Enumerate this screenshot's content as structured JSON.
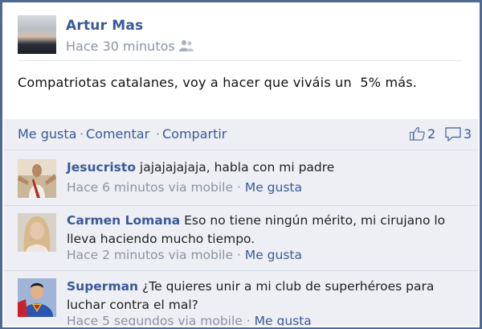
{
  "post": {
    "author": "Artur Mas",
    "time": "Hace 30 minutos",
    "text": "Compatriotas catalanes, voy a hacer que viváis un  5% más.",
    "audience_icon": "friends-icon"
  },
  "actions": {
    "like": "Me gusta",
    "dot1": "·",
    "comment": "Comentar",
    "dot2": "·",
    "share": "Compartir",
    "like_count": "2",
    "comment_count": "3"
  },
  "comments": [
    {
      "name": "Jesucristo",
      "text": "jajajajajaja, habla con mi padre",
      "time": "Hace 6 minutos via mobile",
      "sep": "·",
      "like": "Me gusta"
    },
    {
      "name": "Carmen Lomana",
      "text": "Eso no tiene ningún mérito,  mi cirujano lo lleva haciendo mucho tiempo.",
      "time": "Hace 2 minutos via mobile",
      "sep": "·",
      "like": "Me gusta"
    },
    {
      "name": "Superman",
      "text": "¿Te quieres unir a mi club de superhéroes para luchar contra el mal?",
      "time": "Hace 5 segundos via mobile",
      "sep": "·",
      "like": "Me gusta"
    }
  ],
  "colors": {
    "link": "#3b5998",
    "meta": "#8b93a2",
    "comment_bg": "#edeff4",
    "frame": "#4f6996"
  }
}
